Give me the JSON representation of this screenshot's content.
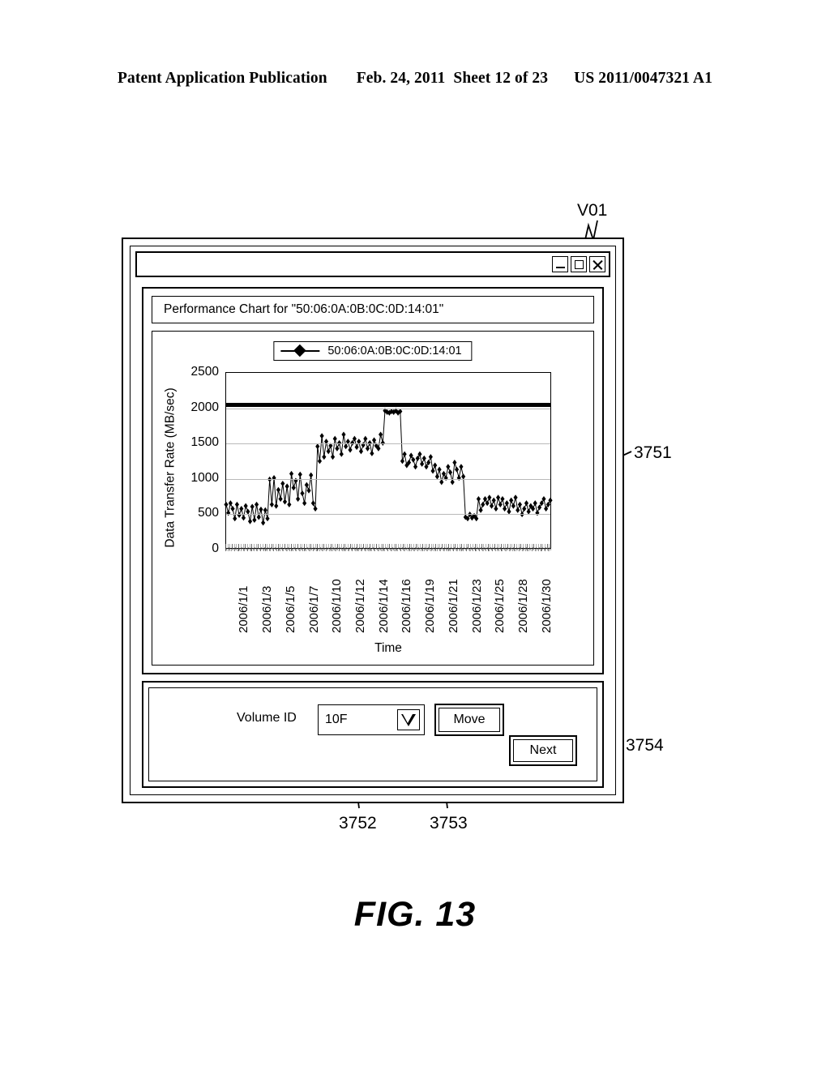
{
  "patent_header": {
    "publication": "Patent Application Publication",
    "date": "Feb. 24, 2011",
    "sheet": "Sheet 12 of 23",
    "number": "US 2011/0047321 A1"
  },
  "figure": {
    "caption": "FIG. 13",
    "callouts": [
      {
        "id": "v01",
        "label": "V01"
      },
      {
        "id": "r3751",
        "label": "3751"
      },
      {
        "id": "r3752",
        "label": "3752"
      },
      {
        "id": "r3753",
        "label": "3753"
      },
      {
        "id": "r3754",
        "label": "3754"
      }
    ]
  },
  "window": {
    "titlebar": {
      "minimize_label": "–",
      "maximize_label": "□",
      "close_label": "✕",
      "minimize_icon": "minimize-icon",
      "maximize_icon": "maximize-icon",
      "close_icon": "close-icon"
    },
    "chart_panel": {
      "header": "Performance Chart for \"50:06:0A:0B:0C:0D:14:01\""
    },
    "controls": {
      "volume_id_label": "Volume ID",
      "volume_id_value": "10F",
      "volume_id_arrow_icon": "chevron-down-icon",
      "move_button": "Move",
      "next_button": "Next"
    }
  },
  "chart_data": {
    "type": "line",
    "title": "",
    "xlabel": "Time",
    "ylabel": "Data Transfer Rate  (MB/sec)",
    "ylim": [
      0,
      2500
    ],
    "yticks": [
      0,
      500,
      1000,
      1500,
      2000,
      2500
    ],
    "grid": true,
    "legend_position": "top-center",
    "legend": [
      "50:06:0A:0B:0C:0D:14:01"
    ],
    "threshold": {
      "value": 2050,
      "style": "thick-solid-black"
    },
    "marker": "diamond",
    "xtick_labels": [
      "2006/1/1",
      "2006/1/3",
      "2006/1/5",
      "2006/1/7",
      "2006/1/10",
      "2006/1/12",
      "2006/1/14",
      "2006/1/16",
      "2006/1/19",
      "2006/1/21",
      "2006/1/23",
      "2006/1/25",
      "2006/1/28",
      "2006/1/30"
    ],
    "series": [
      {
        "name": "50:06:0A:0B:0C:0D:14:01",
        "values": [
          620,
          500,
          640,
          560,
          420,
          620,
          470,
          560,
          430,
          600,
          520,
          380,
          590,
          400,
          620,
          440,
          550,
          360,
          540,
          420,
          980,
          620,
          1000,
          600,
          830,
          700,
          920,
          660,
          880,
          620,
          1060,
          860,
          960,
          700,
          1050,
          780,
          640,
          900,
          820,
          1040,
          640,
          560,
          1450,
          1240,
          1600,
          1300,
          1520,
          1380,
          1460,
          1300,
          1560,
          1420,
          1500,
          1340,
          1620,
          1450,
          1520,
          1400,
          1500,
          1560,
          1440,
          1520,
          1380,
          1470,
          1560,
          1420,
          1500,
          1350,
          1540,
          1460,
          1420,
          1620,
          1500,
          1960,
          1940,
          1930,
          1950,
          1940,
          1960,
          1930,
          1950,
          1240,
          1340,
          1180,
          1220,
          1320,
          1260,
          1160,
          1280,
          1340,
          1200,
          1280,
          1160,
          1220,
          1300,
          1100,
          1180,
          1020,
          1120,
          940,
          1060,
          1000,
          1160,
          1080,
          940,
          1220,
          1120,
          1000,
          1160,
          1020,
          440,
          420,
          480,
          430,
          460,
          420,
          700,
          540,
          620,
          700,
          640,
          720,
          600,
          680,
          560,
          720,
          620,
          700,
          560,
          640,
          520,
          680,
          600,
          720,
          540,
          620,
          480,
          560,
          640,
          520,
          600,
          560,
          640,
          500,
          580,
          640,
          700,
          560,
          620,
          680
        ]
      }
    ]
  }
}
